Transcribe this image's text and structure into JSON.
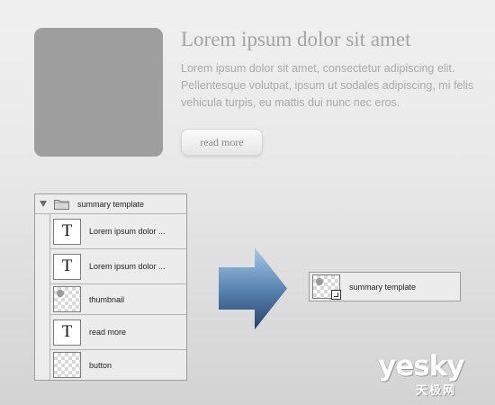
{
  "preview": {
    "title": "Lorem ipsum dolor sit amet",
    "body": "Lorem ipsum dolor sit amet, consectetur adipiscing elit. Pellentesque volutpat, ipsum ut sodales adipiscing, mi felis vehicula turpis, eu mattis dui nunc nec eros.",
    "read_more_label": "read more"
  },
  "layers": {
    "group": {
      "name": "summary template",
      "icon": "folder-icon",
      "expanded": true
    },
    "items": [
      {
        "name": "Lorem ipsum dolor ...",
        "thumb": "text-layer-icon",
        "glyph": "T"
      },
      {
        "name": "Lorem ipsum dolor ...",
        "thumb": "text-layer-icon",
        "glyph": "T"
      },
      {
        "name": "thumbnail",
        "thumb": "shape-thumbnail-icon"
      },
      {
        "name": "read more",
        "thumb": "text-layer-icon",
        "glyph": "T"
      },
      {
        "name": "button",
        "thumb": "transparent-thumbnail-icon"
      }
    ]
  },
  "smart_object": {
    "name": "summary template",
    "icon": "smart-object-icon"
  },
  "arrow": {
    "icon": "right-arrow-icon",
    "color_top": "#9ec4e0",
    "color_bottom": "#2b4a70"
  },
  "watermark": {
    "text": "yesky",
    "text_cn": "天极网"
  },
  "colors": {
    "thumbnail_gray": "#9e9e9e",
    "text_gray": "#a9a9a9",
    "panel_bg": "#ececec"
  }
}
